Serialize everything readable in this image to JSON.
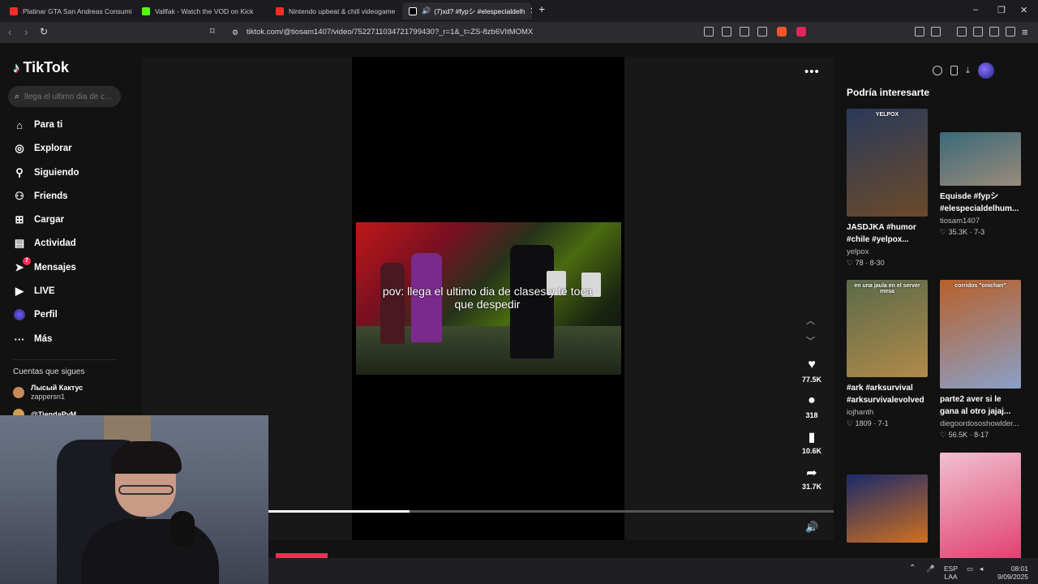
{
  "browser": {
    "tabs": [
      {
        "label": "Platinar GTA San Andreas Consumie",
        "color": "#ff2a2a",
        "active": false
      },
      {
        "label": "Vallfak - Watch the VOD on Kick",
        "color": "#53fc18",
        "active": false
      },
      {
        "label": "Nintendo upbeat & chill videogame",
        "color": "#ff2a2a",
        "active": false
      },
      {
        "label": "(7)xd? #fypシ #elespecialdelh",
        "color": "#ffffff",
        "active": true
      }
    ],
    "new_tab": "+",
    "url": "tiktok.com/@tiosam1407/video/7522711034721799430?_r=1&_t=ZS-8zb6VItMOMX"
  },
  "sidebar": {
    "logo": "TikTok",
    "search_placeholder": "llega el ultimo dia de c...",
    "nav": [
      {
        "label": "Para ti",
        "icon": "home-icon",
        "glyph": "⌂"
      },
      {
        "label": "Explorar",
        "icon": "compass-icon",
        "glyph": "◎"
      },
      {
        "label": "Siguiendo",
        "icon": "person-icon",
        "glyph": "☺"
      },
      {
        "label": "Friends",
        "icon": "friends-icon",
        "glyph": "⚇"
      },
      {
        "label": "Cargar",
        "icon": "upload-icon",
        "glyph": "⊞"
      },
      {
        "label": "Actividad",
        "icon": "activity-icon",
        "glyph": "▤"
      },
      {
        "label": "Mensajes",
        "icon": "messages-icon",
        "glyph": "➤",
        "badge": "7"
      },
      {
        "label": "LIVE",
        "icon": "live-icon",
        "glyph": "▶"
      },
      {
        "label": "Perfil",
        "icon": "profile-avatar-icon",
        "glyph": "●"
      },
      {
        "label": "Más",
        "icon": "more-icon",
        "glyph": "···"
      }
    ],
    "following_title": "Cuentas que sigues",
    "following": [
      {
        "name": "Лысый Кактус",
        "handle": "zappersn1"
      },
      {
        "name": "@TiendaPvM",
        "handle": ""
      }
    ]
  },
  "video": {
    "caption": "pov: llega el ultimo dia de clases y te toca que despedir",
    "likes": "77.5K",
    "comments": "318",
    "saves": "10.6K",
    "shares": "31.7K",
    "progress": 0.25
  },
  "recommended": {
    "title": "Podría interesarte",
    "cards": [
      {
        "title": "JASDJKA #humor #chile #yelpox...",
        "author": "yelpox",
        "likes": "78",
        "date": "8-30",
        "thumb_label": "YELPOX",
        "colors": [
          "#2a3a5a",
          "#6b4a2a"
        ]
      },
      {
        "title": "Equisde #fypシ #elespecialdelhum...",
        "author": "tiosam1407",
        "likes": "35.3K",
        "date": "7-3",
        "thumb_label": "",
        "colors": [
          "#3a6a7a",
          "#9a8a7a"
        ]
      },
      {
        "title": "#ark #arksurvival #arksurvivalevolved",
        "author": "iojhanth",
        "likes": "1809",
        "date": "7-1",
        "thumb_label": "en una jaula en el server mesa",
        "colors": [
          "#5a6a4a",
          "#b08a4a"
        ]
      },
      {
        "title": "parte2 aver si le gana al otro jajaj...",
        "author": "diegoordososhowlder...",
        "likes": "56.5K",
        "date": "8-17",
        "thumb_label": "corridos \"onichan\"",
        "colors": [
          "#b8602a",
          "#8aa0c8"
        ]
      },
      {
        "title": "",
        "author": "",
        "likes": "",
        "date": "",
        "thumb_label": "",
        "colors": [
          "#1a2a6a",
          "#d07020"
        ]
      },
      {
        "title": "",
        "author": "",
        "likes": "",
        "date": "",
        "thumb_label": "",
        "colors": [
          "#f0c0d0",
          "#e04070"
        ]
      }
    ]
  },
  "tray": {
    "lang": "ESP",
    "layout": "LAA",
    "time": "08:01",
    "date": "9/09/2025"
  }
}
